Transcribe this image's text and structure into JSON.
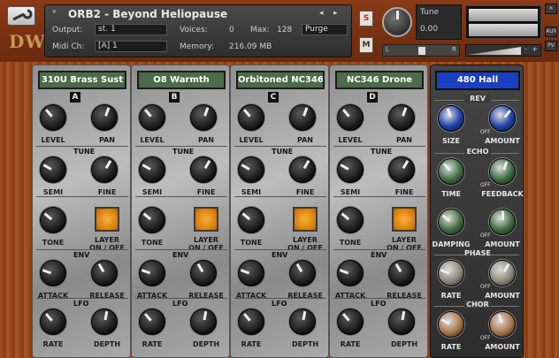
{
  "header": {
    "title": "ORB2 - Beyond Heliopause",
    "logo": "DW",
    "output_label": "Output:",
    "output_value": "st. 1",
    "voices_label": "Voices:",
    "voices_value": "0",
    "max_label": "Max:",
    "max_value": "128",
    "purge_label": "Purge",
    "midi_label": "Midi Ch:",
    "midi_value": "[A]  1",
    "memory_label": "Memory:",
    "memory_value": "216.09 MB",
    "solo_label": "S",
    "mute_label": "M",
    "tune_label": "Tune",
    "tune_value": "0.00",
    "pan_left": "L",
    "pan_right": "R",
    "vol_minus": "-",
    "vol_plus": "+",
    "aux_label": "AUX",
    "pv_label": "PV",
    "icons": [
      "wrench-icon",
      "instrument-icon",
      "prev-arrow-icon",
      "next-arrow-icon",
      "camera-icon",
      "info-icon",
      "close-icon"
    ]
  },
  "labels": {
    "level": "LEVEL",
    "pan": "PAN",
    "tune": "TUNE",
    "semi": "SEMI",
    "fine": "FINE",
    "tone": "TONE",
    "layer": "LAYER",
    "onoff": "ON / OFF",
    "env": "ENV",
    "attack": "ATTACK",
    "release": "RELEASE",
    "lfo": "LFO",
    "rate": "RATE",
    "depth": "DEPTH"
  },
  "channels": [
    {
      "id": "A",
      "preset": "310U Brass Sust"
    },
    {
      "id": "B",
      "preset": "O8 Warmth"
    },
    {
      "id": "C",
      "preset": "Orbitoned NC346"
    },
    {
      "id": "D",
      "preset": "NC346 Drone"
    }
  ],
  "reverb": {
    "preset": "480 Hall",
    "rev": "REV",
    "size": "SIZE",
    "amount": "AMOUNT",
    "echo": "ECHO",
    "time": "TIME",
    "feedback": "FEEDBACK",
    "damping": "DAMPING",
    "phase": "PHASE",
    "rate": "RATE",
    "chor": "CHOR",
    "off": "OFF"
  }
}
